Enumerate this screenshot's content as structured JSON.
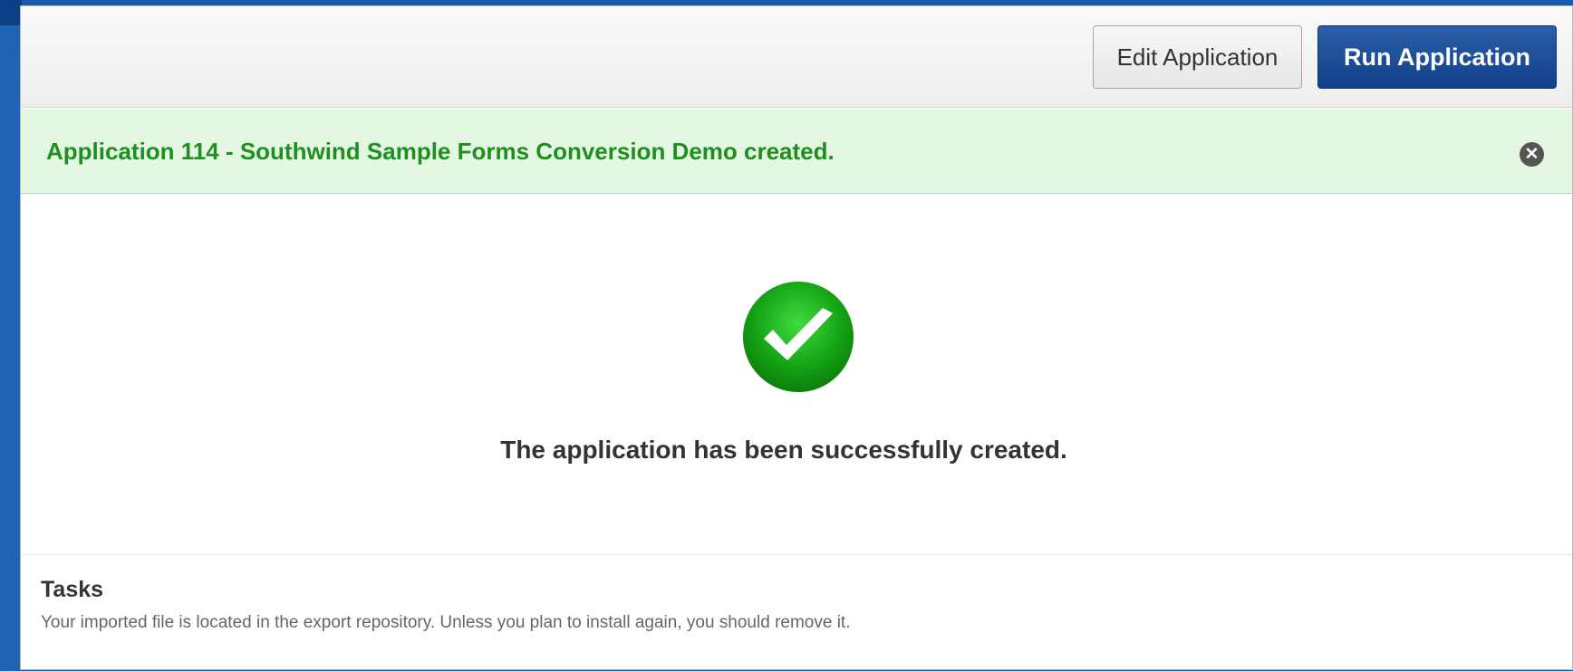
{
  "toolbar": {
    "edit_label": "Edit Application",
    "run_label": "Run Application"
  },
  "banner": {
    "message": "Application 114 - Southwind Sample Forms Conversion Demo created.",
    "close_icon": "close-icon"
  },
  "main": {
    "status_icon": "checkmark-icon",
    "message": "The application has been successfully created."
  },
  "tasks": {
    "title": "Tasks",
    "description": "Your imported file is located in the export repository. Unless you plan to install again, you should remove it."
  },
  "colors": {
    "primary_button": "#13408a",
    "success_text": "#1f8f1f",
    "success_background": "#e3f7e3",
    "check_green": "#14a314"
  }
}
